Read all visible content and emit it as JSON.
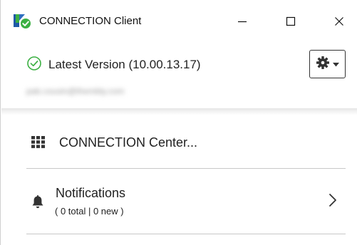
{
  "window": {
    "title": "CONNECTION Client"
  },
  "status": {
    "text": "Latest Version (10.00.13.17)",
    "color": "#3cb043"
  },
  "user": {
    "email": "pab.cousin@thembly.com"
  },
  "menu": {
    "center_label": "CONNECTION Center...",
    "notifications_label": "Notifications",
    "notifications_counts": "( 0 total | 0 new )"
  },
  "icons": {
    "app": "connection-logo-icon",
    "status": "check-circle-icon",
    "settings": "gear-icon",
    "dropdown": "caret-down-icon",
    "center": "grid-icon",
    "notifications": "bell-icon",
    "chevron": "chevron-right-icon"
  },
  "colors": {
    "logo_blue": "#1f5aa6",
    "logo_green": "#3cb043",
    "divider": "#c8c8c8"
  }
}
